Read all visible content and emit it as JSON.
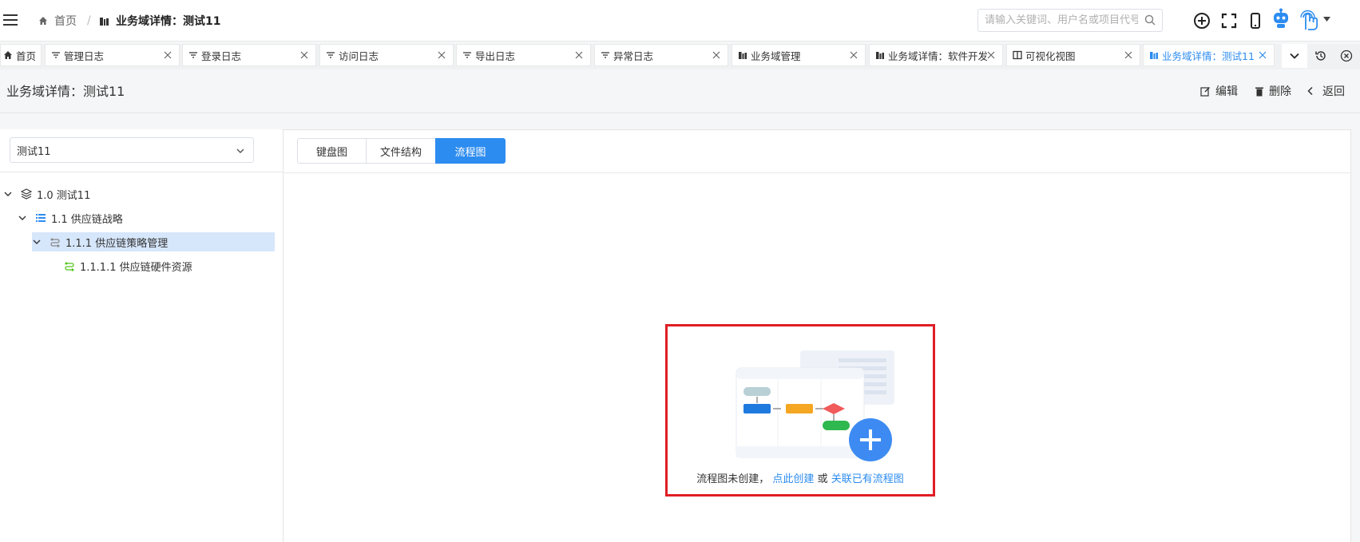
{
  "header": {
    "breadcrumb": {
      "home": "首页",
      "separator": "/",
      "current": "业务域详情：测试11"
    },
    "search": {
      "placeholder": "请输入关键词、用户名或项目代号",
      "value": ""
    },
    "icons": [
      "menu-icon",
      "home-icon",
      "building-icon",
      "search-icon",
      "add-circle-icon",
      "fullscreen-icon",
      "mobile-icon",
      "robot-icon",
      "touch-icon",
      "caret-down-icon"
    ]
  },
  "tabs": [
    {
      "label": "首页",
      "icon": "home-icon",
      "closable": false
    },
    {
      "label": "管理日志",
      "icon": "filter-icon",
      "closable": true
    },
    {
      "label": "登录日志",
      "icon": "filter-icon",
      "closable": true
    },
    {
      "label": "访问日志",
      "icon": "filter-icon",
      "closable": true
    },
    {
      "label": "导出日志",
      "icon": "filter-icon",
      "closable": true
    },
    {
      "label": "异常日志",
      "icon": "filter-icon",
      "closable": true
    },
    {
      "label": "业务域管理",
      "icon": "building-icon",
      "closable": true
    },
    {
      "label": "业务域详情：软件开发",
      "icon": "building-icon",
      "closable": true
    },
    {
      "label": "可视化视图",
      "icon": "book-icon",
      "closable": true
    },
    {
      "label": "业务域详情：测试11",
      "icon": "building-icon",
      "closable": true,
      "active": true
    }
  ],
  "page": {
    "title": "业务域详情：测试11",
    "actions": {
      "edit": "编辑",
      "delete": "删除",
      "back": "返回"
    }
  },
  "left": {
    "select_value": "测试11",
    "tree": [
      {
        "label": "1.0 测试11",
        "level": 0,
        "icon": "layers-icon",
        "expanded": true
      },
      {
        "label": "1.1 供应链战略",
        "level": 1,
        "icon": "list-icon",
        "expanded": true
      },
      {
        "label": "1.1.1 供应链策略管理",
        "level": 2,
        "icon": "process-icon",
        "expanded": true,
        "selected": true
      },
      {
        "label": "1.1.1.1 供应链硬件资源",
        "level": 3,
        "icon": "process-icon"
      }
    ]
  },
  "right": {
    "view_tabs": [
      "键盘图",
      "文件结构",
      "流程图"
    ],
    "active_view": "流程图",
    "empty": {
      "prefix": "流程图未创建，",
      "create_link": "点此创建",
      "or": "或",
      "relate_link": "关联已有流程图"
    }
  },
  "colors": {
    "accent": "#2d8cf0",
    "highlight": "#e01e25",
    "selected_row": "#d6e6fb"
  }
}
